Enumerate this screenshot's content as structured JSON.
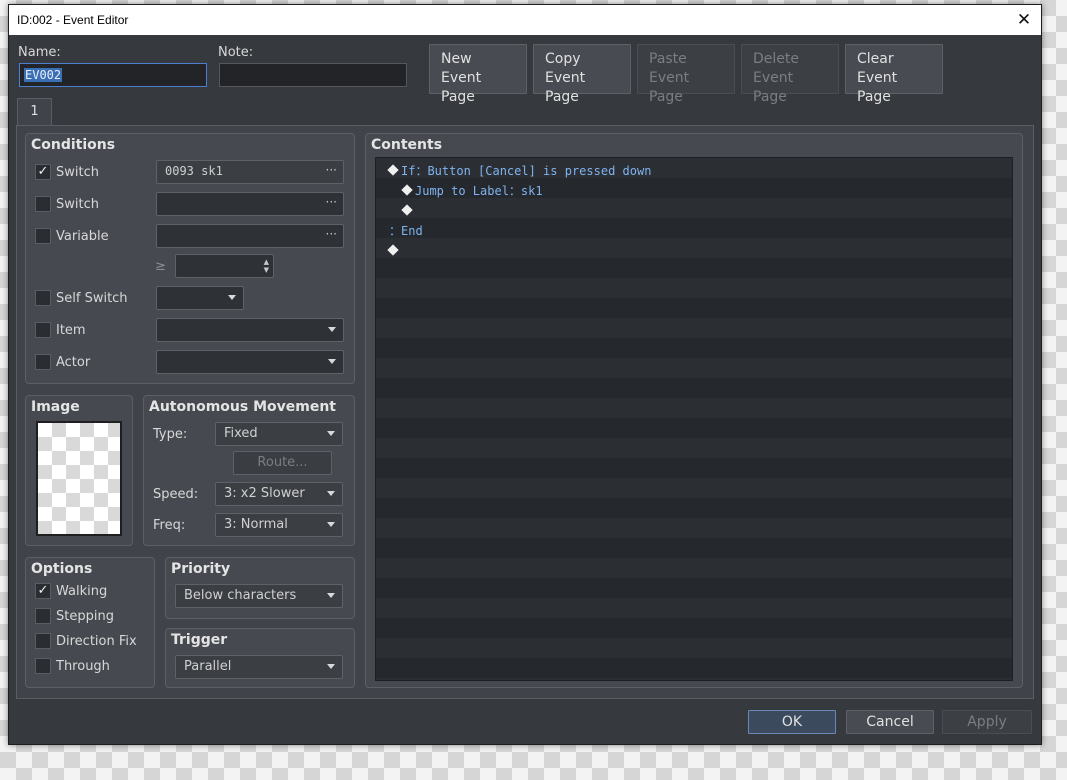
{
  "window": {
    "title": "ID:002 - Event Editor",
    "close_glyph": "✕"
  },
  "header": {
    "name_label": "Name:",
    "name_value": "EV002",
    "note_label": "Note:",
    "note_value": ""
  },
  "page_buttons": [
    {
      "line1": "New",
      "line2": "Event Page",
      "enabled": true
    },
    {
      "line1": "Copy",
      "line2": "Event Page",
      "enabled": true
    },
    {
      "line1": "Paste",
      "line2": "Event Page",
      "enabled": false
    },
    {
      "line1": "Delete",
      "line2": "Event Page",
      "enabled": false
    },
    {
      "line1": "Clear",
      "line2": "Event Page",
      "enabled": true
    }
  ],
  "tabs": [
    {
      "label": "1",
      "active": true
    }
  ],
  "conditions": {
    "title": "Conditions",
    "switch1": {
      "label": "Switch",
      "checked": true,
      "value": "0093 sk1",
      "icon": "ellipsis-icon"
    },
    "switch2": {
      "label": "Switch",
      "checked": false,
      "value": ""
    },
    "variable": {
      "label": "Variable",
      "checked": false,
      "value": "",
      "compare": "≥",
      "amount": ""
    },
    "self_switch": {
      "label": "Self Switch",
      "checked": false,
      "value": ""
    },
    "item": {
      "label": "Item",
      "checked": false,
      "value": ""
    },
    "actor": {
      "label": "Actor",
      "checked": false,
      "value": ""
    },
    "dots": "···"
  },
  "image": {
    "title": "Image"
  },
  "autonomous_movement": {
    "title": "Autonomous Movement",
    "type_label": "Type:",
    "type_value": "Fixed",
    "route_label": "Route...",
    "speed_label": "Speed:",
    "speed_value": "3: x2 Slower",
    "freq_label": "Freq:",
    "freq_value": "3: Normal"
  },
  "options": {
    "title": "Options",
    "items": [
      {
        "label": "Walking",
        "checked": true
      },
      {
        "label": "Stepping",
        "checked": false
      },
      {
        "label": "Direction Fix",
        "checked": false
      },
      {
        "label": "Through",
        "checked": false
      }
    ]
  },
  "priority": {
    "title": "Priority",
    "value": "Below characters"
  },
  "trigger": {
    "title": "Trigger",
    "value": "Parallel"
  },
  "contents": {
    "title": "Contents",
    "commands": [
      {
        "text": "If：Button [Cancel] is pressed down",
        "indent": 0,
        "marker": "diamond"
      },
      {
        "text": "Jump to Label：sk1",
        "indent": 1,
        "marker": "diamond"
      },
      {
        "text": "",
        "indent": 1,
        "marker": "diamond"
      },
      {
        "text": "：End",
        "indent": 0,
        "marker": "none"
      },
      {
        "text": "",
        "indent": 0,
        "marker": "diamond"
      }
    ]
  },
  "footer": {
    "ok": "OK",
    "cancel": "Cancel",
    "apply": "Apply"
  },
  "colors": {
    "accent": "#3b6fb5",
    "command_text": "#7fb3f0",
    "window_bg": "#363a3f"
  }
}
